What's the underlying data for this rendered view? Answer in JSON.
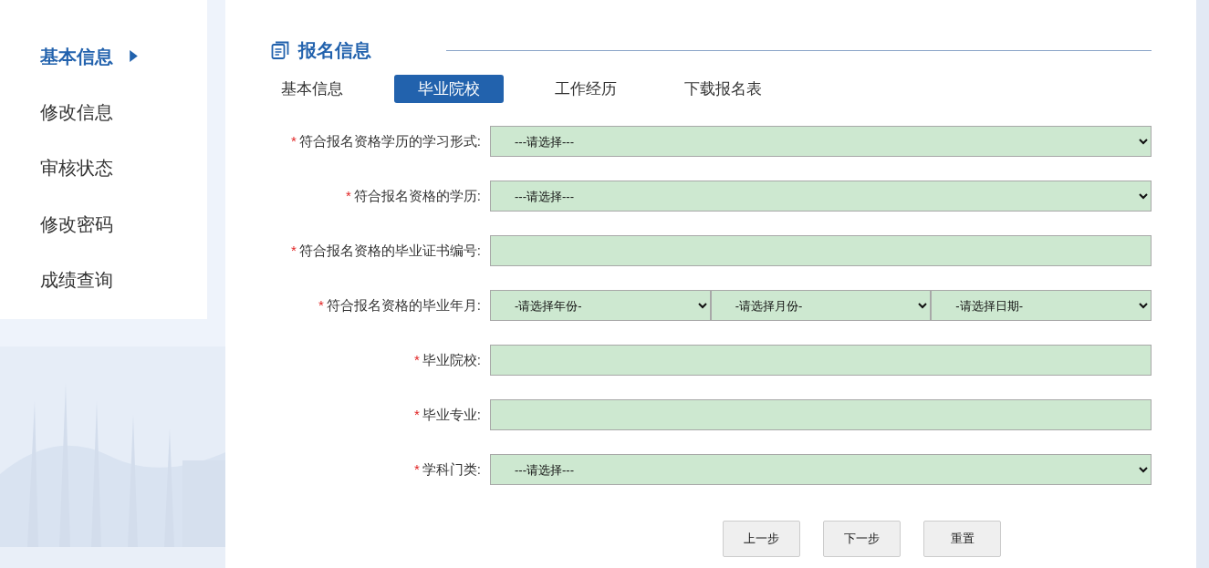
{
  "sidebar": {
    "items": [
      {
        "label": "基本信息",
        "selected": true
      },
      {
        "label": "修改信息",
        "selected": false
      },
      {
        "label": "审核状态",
        "selected": false
      },
      {
        "label": "修改密码",
        "selected": false
      },
      {
        "label": "成绩查询",
        "selected": false
      }
    ]
  },
  "section": {
    "title": "报名信息"
  },
  "tabs": [
    {
      "label": "基本信息",
      "selected": false
    },
    {
      "label": "毕业院校",
      "selected": true
    },
    {
      "label": "工作经历",
      "selected": false
    },
    {
      "label": "下载报名表",
      "selected": false
    }
  ],
  "form": {
    "fields": [
      {
        "kind": "select",
        "mark": "*",
        "label": "符合报名资格学历的学习形式:",
        "values": [
          "---请选择---"
        ]
      },
      {
        "kind": "select",
        "mark": "*",
        "label": "符合报名资格的学历:",
        "values": [
          "---请选择---"
        ]
      },
      {
        "kind": "text",
        "mark": "*",
        "label": "符合报名资格的毕业证书编号:"
      },
      {
        "kind": "select",
        "mark": "*",
        "label": "符合报名资格的毕业年月:",
        "values": [
          "-请选择年份-",
          "-请选择月份-",
          "-请选择日期-"
        ]
      },
      {
        "kind": "text",
        "mark": "*",
        "label": "毕业院校:"
      },
      {
        "kind": "text",
        "mark": "*",
        "label": "毕业专业:"
      },
      {
        "kind": "select",
        "mark": "*",
        "label": "学科门类:",
        "values": [
          "---请选择---"
        ]
      }
    ]
  },
  "buttons": [
    "上一步",
    "下一步",
    "重置"
  ]
}
